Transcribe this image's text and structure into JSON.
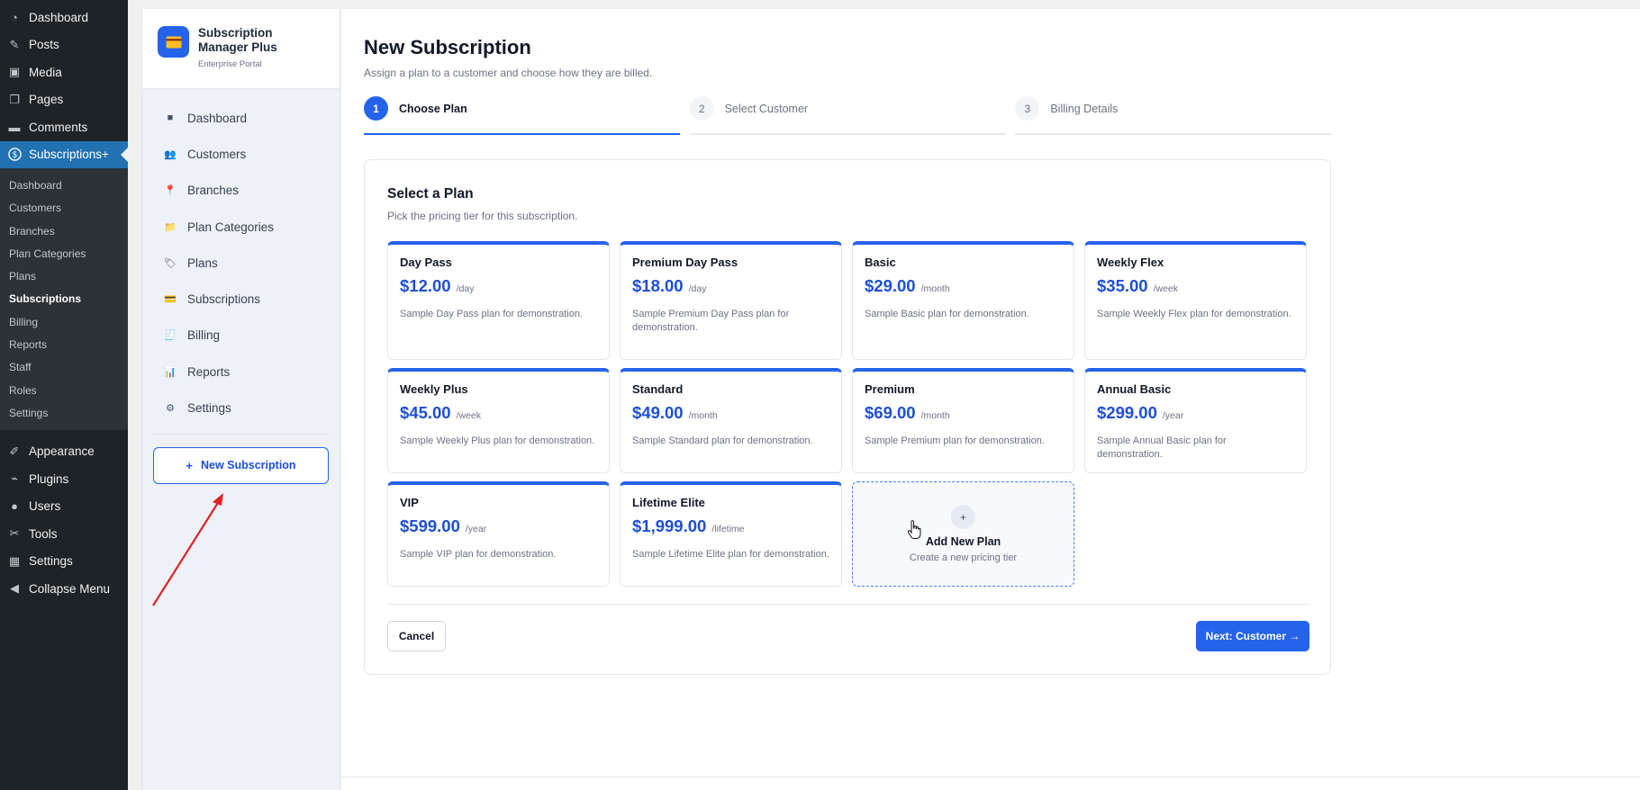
{
  "wp_menu": {
    "top_items": [
      {
        "label": "Dashboard",
        "icon": "dashboard-icon"
      },
      {
        "label": "Posts",
        "icon": "pin-icon"
      },
      {
        "label": "Media",
        "icon": "media-icon"
      },
      {
        "label": "Pages",
        "icon": "pages-icon"
      },
      {
        "label": "Comments",
        "icon": "comments-icon"
      }
    ],
    "active_item": {
      "label": "Subscriptions+",
      "icon": "dollar-icon"
    },
    "sub_items": [
      "Dashboard",
      "Customers",
      "Branches",
      "Plan Categories",
      "Plans",
      "Subscriptions",
      "Billing",
      "Reports",
      "Staff",
      "Roles",
      "Settings"
    ],
    "current_sub": "Subscriptions",
    "bottom_items": [
      {
        "label": "Appearance",
        "icon": "brush-icon"
      },
      {
        "label": "Plugins",
        "icon": "plugin-icon"
      },
      {
        "label": "Users",
        "icon": "user-icon"
      },
      {
        "label": "Tools",
        "icon": "wrench-icon"
      },
      {
        "label": "Settings",
        "icon": "settings-icon"
      },
      {
        "label": "Collapse Menu",
        "icon": "collapse-icon"
      }
    ]
  },
  "plugin": {
    "brand_name": "Subscription Manager Plus",
    "brand_sub": "Enterprise Portal",
    "nav": [
      {
        "label": "Dashboard",
        "icon": "square-icon",
        "glyph": "■"
      },
      {
        "label": "Customers",
        "icon": "people-icon",
        "glyph": "👥"
      },
      {
        "label": "Branches",
        "icon": "map-pin-icon",
        "glyph": "📍"
      },
      {
        "label": "Plan Categories",
        "icon": "folder-icon",
        "glyph": "📁"
      },
      {
        "label": "Plans",
        "icon": "tag-icon",
        "glyph": "🏷"
      },
      {
        "label": "Subscriptions",
        "icon": "credit-card-icon",
        "glyph": "💳"
      },
      {
        "label": "Billing",
        "icon": "receipt-icon",
        "glyph": "🧾"
      },
      {
        "label": "Reports",
        "icon": "bar-chart-icon",
        "glyph": "📊"
      },
      {
        "label": "Settings",
        "icon": "gear-icon",
        "glyph": "⚙"
      }
    ],
    "new_button": "New Subscription",
    "new_button_plus": "+"
  },
  "main": {
    "title": "New Subscription",
    "subtitle": "Assign a plan to a customer and choose how they are billed.",
    "steps": [
      {
        "num": "1",
        "label": "Choose Plan"
      },
      {
        "num": "2",
        "label": "Select Customer"
      },
      {
        "num": "3",
        "label": "Billing Details"
      }
    ],
    "card_title": "Select a Plan",
    "card_subtitle": "Pick the pricing tier for this subscription.",
    "plans": [
      {
        "name": "Day Pass",
        "price": "$12.00",
        "period": "/day",
        "desc": "Sample Day Pass plan for demonstration."
      },
      {
        "name": "Premium Day Pass",
        "price": "$18.00",
        "period": "/day",
        "desc": "Sample Premium Day Pass plan for demonstration."
      },
      {
        "name": "Basic",
        "price": "$29.00",
        "period": "/month",
        "desc": "Sample Basic plan for demonstration."
      },
      {
        "name": "Weekly Flex",
        "price": "$35.00",
        "period": "/week",
        "desc": "Sample Weekly Flex plan for demonstration."
      },
      {
        "name": "Weekly Plus",
        "price": "$45.00",
        "period": "/week",
        "desc": "Sample Weekly Plus plan for demonstration."
      },
      {
        "name": "Standard",
        "price": "$49.00",
        "period": "/month",
        "desc": "Sample Standard plan for demonstration."
      },
      {
        "name": "Premium",
        "price": "$69.00",
        "period": "/month",
        "desc": "Sample Premium plan for demonstration."
      },
      {
        "name": "Annual Basic",
        "price": "$299.00",
        "period": "/year",
        "desc": "Sample Annual Basic plan for demonstration."
      },
      {
        "name": "VIP",
        "price": "$599.00",
        "period": "/year",
        "desc": "Sample VIP plan for demonstration."
      },
      {
        "name": "Lifetime Elite",
        "price": "$1,999.00",
        "period": "/lifetime",
        "desc": "Sample Lifetime Elite plan for demonstration."
      }
    ],
    "add_plan": {
      "plus": "+",
      "title": "Add New Plan",
      "subtitle": "Create a new pricing tier"
    },
    "cancel": "Cancel",
    "next": "Next: Customer →"
  },
  "colors": {
    "accent": "#2563eb",
    "wp_sidebar": "#1d2327",
    "wp_active": "#2271b1",
    "annotation_arrow": "#e02424"
  }
}
